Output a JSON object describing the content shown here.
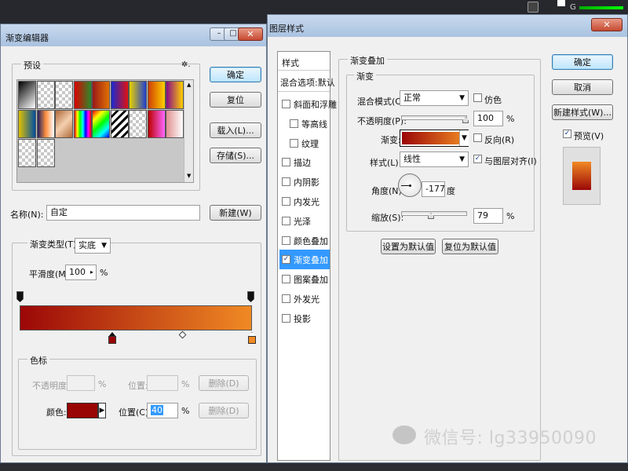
{
  "colors": {
    "gradient_start": "#9b0707",
    "gradient_end": "#f08a24",
    "selected_stop": "#990404",
    "accent_blue": "#3399ff"
  },
  "gradient_editor": {
    "title": "渐变编辑器",
    "window_controls": [
      "–",
      "□",
      "✕"
    ],
    "presets_label": "预设",
    "gear_glyph": "✲.",
    "buttons": {
      "ok": "确定",
      "reset": "复位",
      "load": "载入(L)...",
      "save": "存储(S)...",
      "new": "新建(W)"
    },
    "name_label": "名称(N):",
    "name_value": "自定",
    "type_label": "渐变类型(T):",
    "type_value": "实底",
    "smooth_label": "平滑度(M):",
    "smooth_value": "100",
    "smooth_unit": "%",
    "stops_group": "色标",
    "opacity_label": "不透明度:",
    "opacity_unit": "%",
    "pos1_label": "位置:",
    "pos1_unit": "%",
    "delete1": "删除(D)",
    "color_label": "颜色:",
    "pos2_label": "位置(C):",
    "pos2_value": "40",
    "pos2_unit": "%",
    "delete2": "删除(D)",
    "presets": [
      "linear-gradient(135deg,#000,#fff)",
      "checker-black",
      "checker-black2",
      "linear-gradient(90deg,#d00,#2a8a2a)",
      "linear-gradient(90deg,#9a1a1a,#e07000)",
      "linear-gradient(90deg,#1a2ad0,#e01010)",
      "linear-gradient(90deg,#e8d000,#2040d0)",
      "linear-gradient(90deg,#d04000,#ffd000)",
      "linear-gradient(90deg,#8a0a8a,#ffd000)",
      "linear-gradient(90deg,#e0c000,#0050a0)",
      "linear-gradient(90deg,#202060,#ff9040,#fff)",
      "linear-gradient(135deg,#b06a3a,#f5d0b0,#b06a3a)",
      "linear-gradient(90deg,#f00,#ff0,#0f0,#0ff,#00f,#f0f,#f00)",
      "linear-gradient(135deg,#f00,#ff0,#0f0,#0ff,#00f)",
      "repeating-linear-gradient(135deg,#fff 0 4px,#000 4px 7px)",
      "checker",
      "linear-gradient(90deg,#b00,#f6f)",
      "linear-gradient(90deg,#e09090,#fff)",
      "checker-pink",
      "checker"
    ]
  },
  "layer_style": {
    "title": "图层样式",
    "styles_header": "样式",
    "blend_defaults": "混合选项:默认",
    "styles": [
      {
        "label": "斜面和浮雕",
        "checked": false,
        "indent": false,
        "selected": false
      },
      {
        "label": "等高线",
        "checked": false,
        "indent": true,
        "selected": false
      },
      {
        "label": "纹理",
        "checked": false,
        "indent": true,
        "selected": false
      },
      {
        "label": "描边",
        "checked": false,
        "indent": false,
        "selected": false
      },
      {
        "label": "内阴影",
        "checked": false,
        "indent": false,
        "selected": false
      },
      {
        "label": "内发光",
        "checked": false,
        "indent": false,
        "selected": false
      },
      {
        "label": "光泽",
        "checked": false,
        "indent": false,
        "selected": false
      },
      {
        "label": "颜色叠加",
        "checked": false,
        "indent": false,
        "selected": false
      },
      {
        "label": "渐变叠加",
        "checked": true,
        "indent": false,
        "selected": true
      },
      {
        "label": "图案叠加",
        "checked": false,
        "indent": false,
        "selected": false
      },
      {
        "label": "外发光",
        "checked": false,
        "indent": false,
        "selected": false
      },
      {
        "label": "投影",
        "checked": false,
        "indent": false,
        "selected": false
      }
    ],
    "section_title": "渐变叠加",
    "sub_title": "渐变",
    "blend_mode_label": "混合模式(O):",
    "blend_mode_value": "正常",
    "dither_label": "仿色",
    "opacity_label": "不透明度(P):",
    "opacity_value": "100",
    "opacity_unit": "%",
    "gradient_label": "渐变:",
    "reverse_label": "反向(R)",
    "style_label": "样式(L):",
    "style_value": "线性",
    "align_label": "与图层对齐(I)",
    "angle_label": "角度(N):",
    "angle_value": "-177",
    "angle_unit": "度",
    "scale_label": "缩放(S):",
    "scale_value": "79",
    "scale_unit": "%",
    "set_default": "设置为默认值",
    "reset_default": "复位为默认值",
    "buttons": {
      "ok": "确定",
      "cancel": "取消",
      "new_style": "新建样式(W)..."
    },
    "preview_label": "预览(V)",
    "preview_checked": true,
    "dither_checked": false,
    "reverse_checked": false,
    "align_checked": true
  },
  "top_strip": {
    "g_label": "G"
  },
  "watermark": "微信号: lg33950090"
}
